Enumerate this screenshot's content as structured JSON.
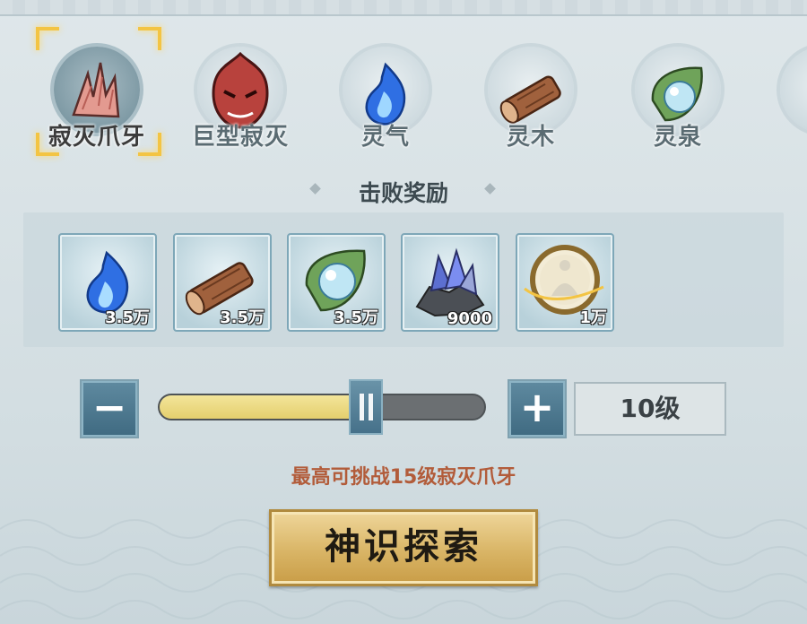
{
  "enemies": [
    {
      "label": "寂灭爪牙",
      "icon": "claw-icon",
      "selected": true
    },
    {
      "label": "巨型寂灭",
      "icon": "red-demon-icon",
      "selected": false
    },
    {
      "label": "灵气",
      "icon": "blue-flame-icon",
      "selected": false
    },
    {
      "label": "灵木",
      "icon": "log-icon",
      "selected": false
    },
    {
      "label": "灵泉",
      "icon": "water-leaf-icon",
      "selected": false
    }
  ],
  "rewards": {
    "title": "击败奖励",
    "items": [
      {
        "icon": "blue-flame-icon",
        "count": "3.5万"
      },
      {
        "icon": "log-icon",
        "count": "3.5万"
      },
      {
        "icon": "water-leaf-icon",
        "count": "3.5万"
      },
      {
        "icon": "crystal-ore-icon",
        "count": "9000"
      },
      {
        "icon": "meditation-medallion-icon",
        "count": "1万"
      }
    ]
  },
  "level_control": {
    "minus_label": "−",
    "plus_label": "+",
    "current_level": 10,
    "max_level": 15,
    "level_display": "10级"
  },
  "max_note": "最高可挑战15级寂灭爪牙",
  "explore_button": "神识探索",
  "colors": {
    "accent_gold": "#f3c443",
    "note_text": "#b25c3a",
    "button_blue": "#4f7b91"
  }
}
